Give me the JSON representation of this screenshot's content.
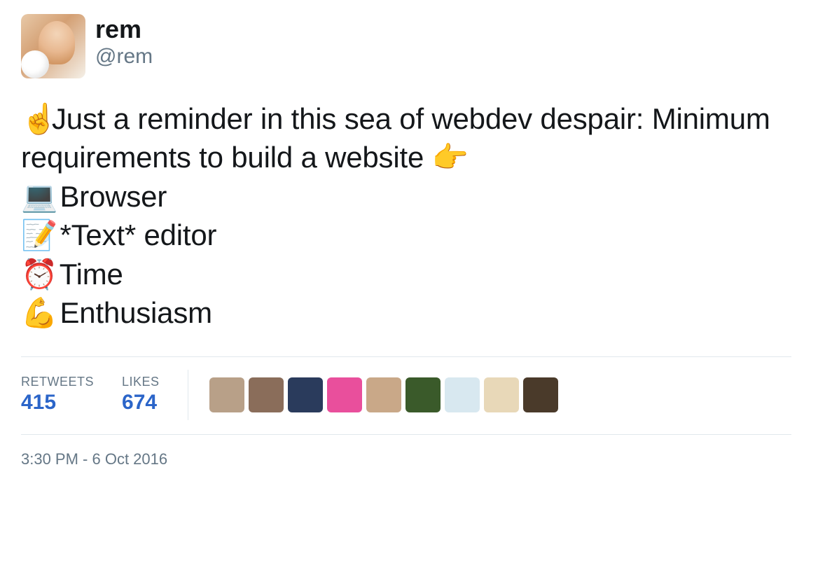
{
  "author": {
    "display_name": "rem",
    "handle": "@rem"
  },
  "tweet": {
    "intro_emoji": "☝️",
    "intro_text": "Just a reminder in this sea of webdev despair: Minimum requirements to build a website ",
    "pointer_emoji": "👉",
    "items": [
      {
        "emoji": "💻",
        "text": " Browser"
      },
      {
        "emoji": "📝",
        "text": " *Text* editor"
      },
      {
        "emoji": "⏰",
        "text": " Time"
      },
      {
        "emoji": "💪",
        "text": " Enthusiasm"
      }
    ]
  },
  "stats": {
    "retweets_label": "Retweets",
    "retweets_value": "415",
    "likes_label": "Likes",
    "likes_value": "674"
  },
  "liker_avatars": [
    {
      "bg": "#b8a088"
    },
    {
      "bg": "#8a6d5a"
    },
    {
      "bg": "#2a3b5c"
    },
    {
      "bg": "#e94f9c"
    },
    {
      "bg": "#c9a888"
    },
    {
      "bg": "#3a5a2a"
    },
    {
      "bg": "#d8e8f0"
    },
    {
      "bg": "#e8d8b8"
    },
    {
      "bg": "#4a3a2a"
    }
  ],
  "timestamp": "3:30 PM - 6 Oct 2016"
}
